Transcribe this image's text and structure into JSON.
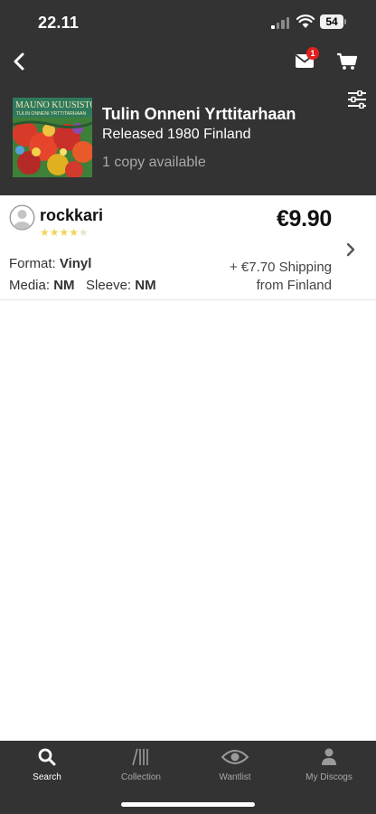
{
  "status_bar": {
    "time": "22.11",
    "battery": "54"
  },
  "header": {
    "notification_count": "1",
    "release": {
      "title": "Tulin Onneni Yrttitarhaan",
      "subtitle": "Released 1980 Finland",
      "copies": "1 copy available",
      "cover_band_text": "MAUNO KUUSISTO",
      "cover_album_text": "TULIN ONNENI YRTTITARHAAN"
    }
  },
  "listing": {
    "seller": "rockkari",
    "rating_stars": 4.5,
    "price": "€9.90",
    "format_label": "Format:",
    "format_value": "Vinyl",
    "media_label": "Media:",
    "media_value": "NM",
    "sleeve_label": "Sleeve:",
    "sleeve_value": "NM",
    "shipping": "+ €7.70 Shipping",
    "ships_from": "from Finland"
  },
  "tabs": [
    {
      "label": "Search",
      "icon": "search-icon",
      "active": true
    },
    {
      "label": "Collection",
      "icon": "collection-icon",
      "active": false
    },
    {
      "label": "Wantlist",
      "icon": "eye-icon",
      "active": false
    },
    {
      "label": "My Discogs",
      "icon": "person-icon",
      "active": false
    }
  ],
  "colors": {
    "header_bg": "#333333",
    "badge": "#e02020",
    "star": "#f3d45a",
    "muted_text": "#a8a8a8"
  }
}
